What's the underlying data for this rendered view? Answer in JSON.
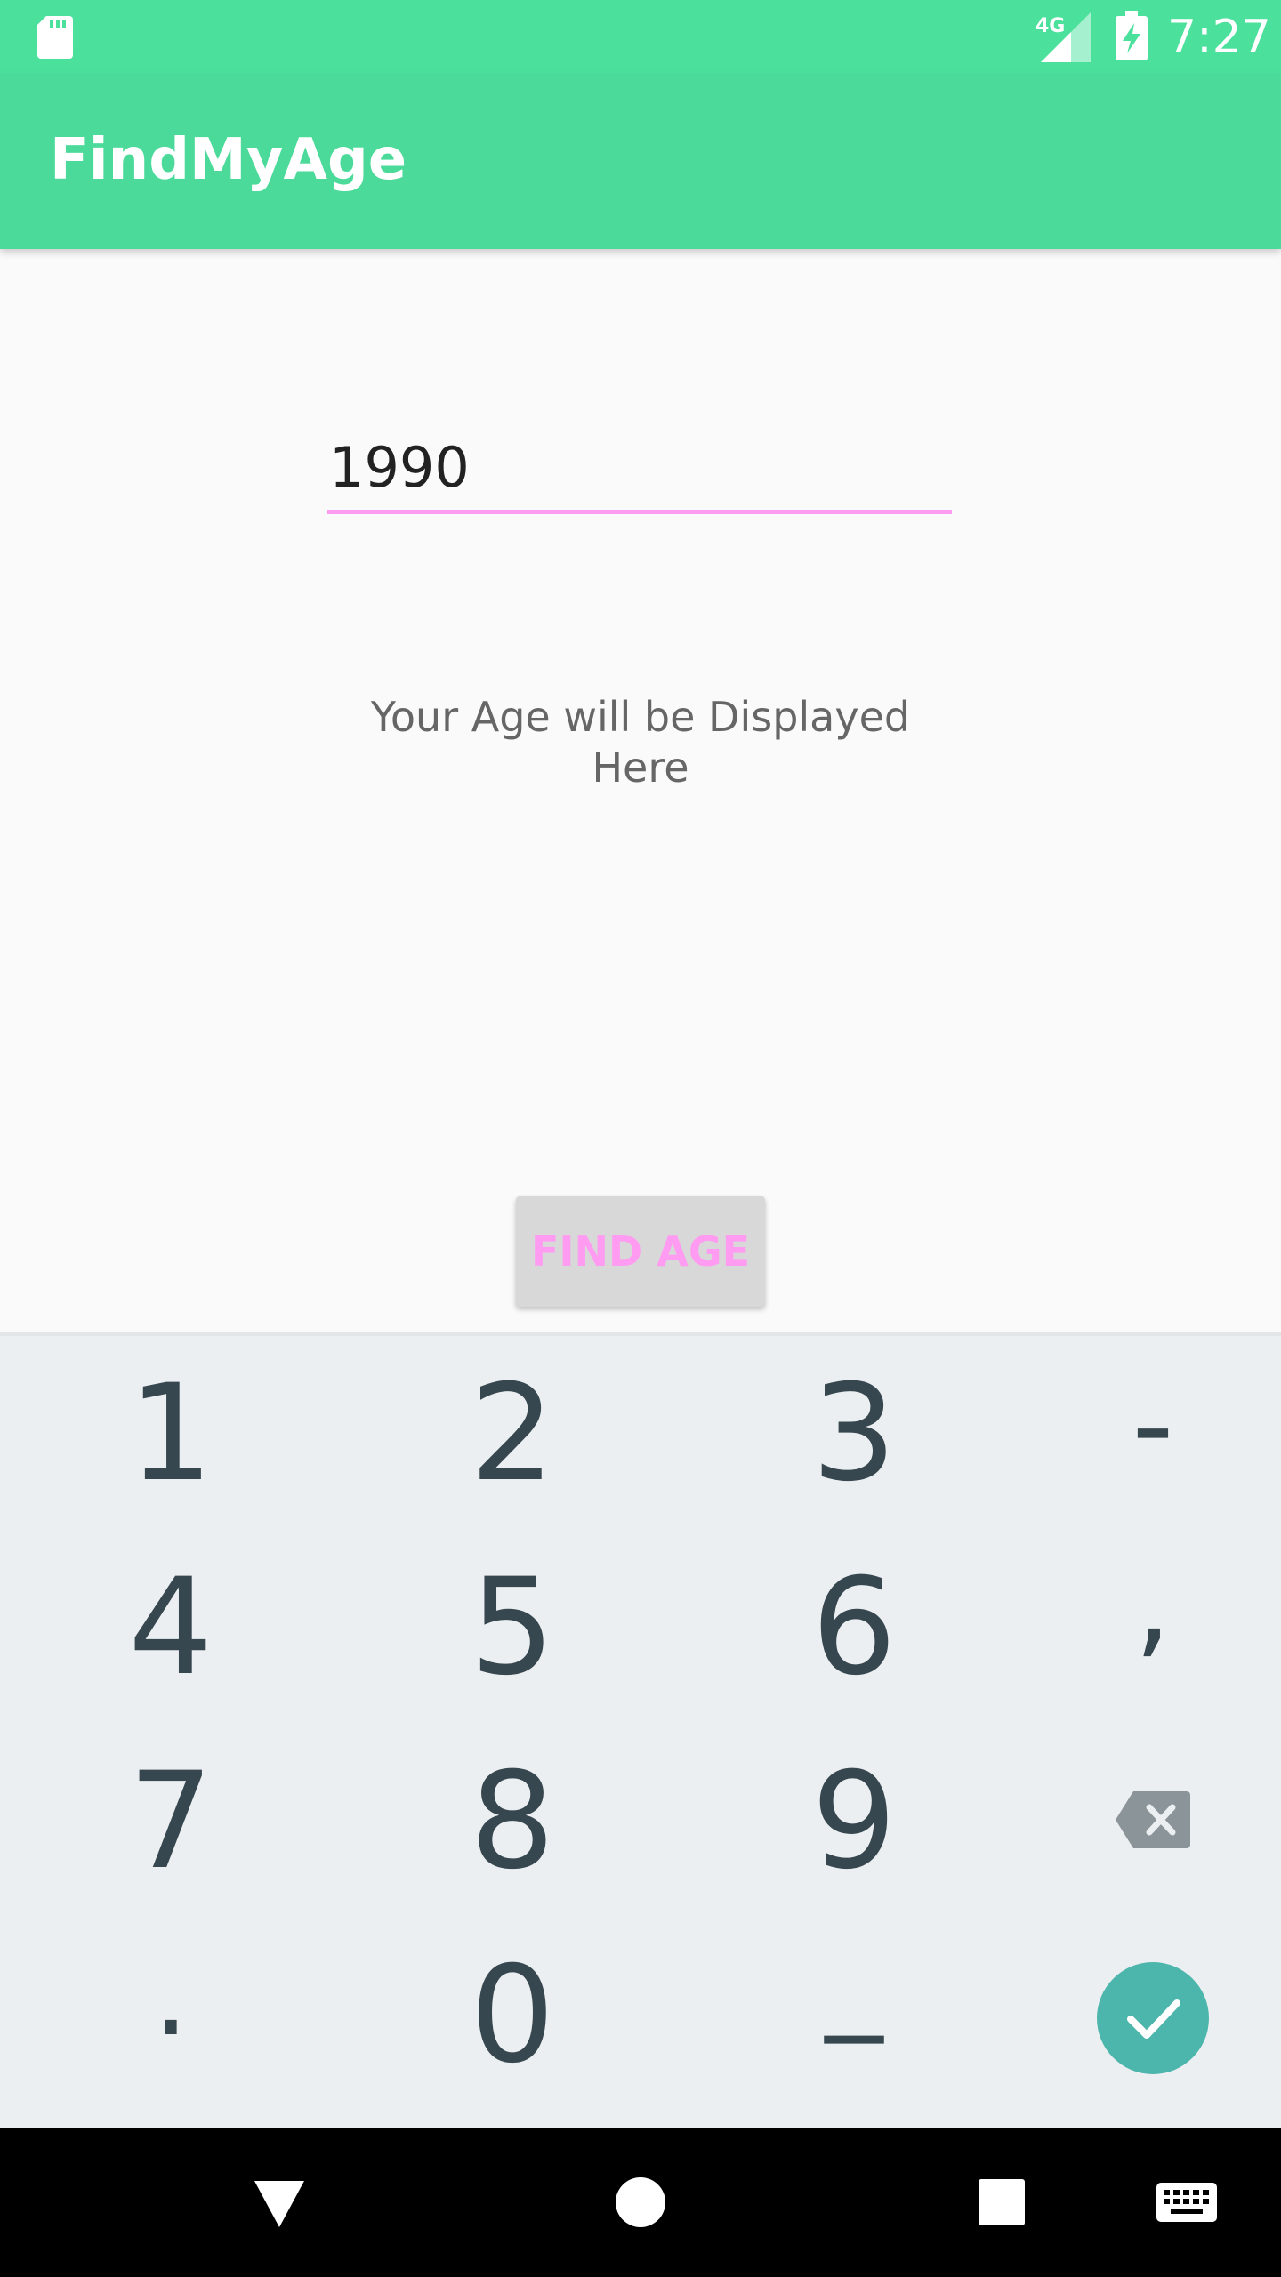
{
  "status_bar": {
    "network": "4G",
    "time": "7:27",
    "colors": {
      "background": "#4be09c"
    }
  },
  "app_bar": {
    "title": "FindMyAge",
    "colors": {
      "background": "#4bda9a"
    }
  },
  "main": {
    "year_input": {
      "value": "1990"
    },
    "age_display": {
      "text": "Your Age will be Displayed Here"
    },
    "find_button": {
      "label": "FIND AGE"
    },
    "colors": {
      "accent": "#ff9cf2"
    }
  },
  "keyboard": {
    "rows": [
      [
        "1",
        "2",
        "3",
        "-"
      ],
      [
        "4",
        "5",
        "6",
        ","
      ],
      [
        "7",
        "8",
        "9",
        "backspace-icon"
      ],
      [
        ".",
        "0",
        "_",
        "check-icon"
      ]
    ],
    "colors": {
      "background": "#eceff1",
      "enter": "#4db6ac"
    }
  },
  "nav_bar": {
    "icons": [
      "back-triangle-icon",
      "home-circle-icon",
      "recents-square-icon",
      "keyboard-icon"
    ]
  }
}
